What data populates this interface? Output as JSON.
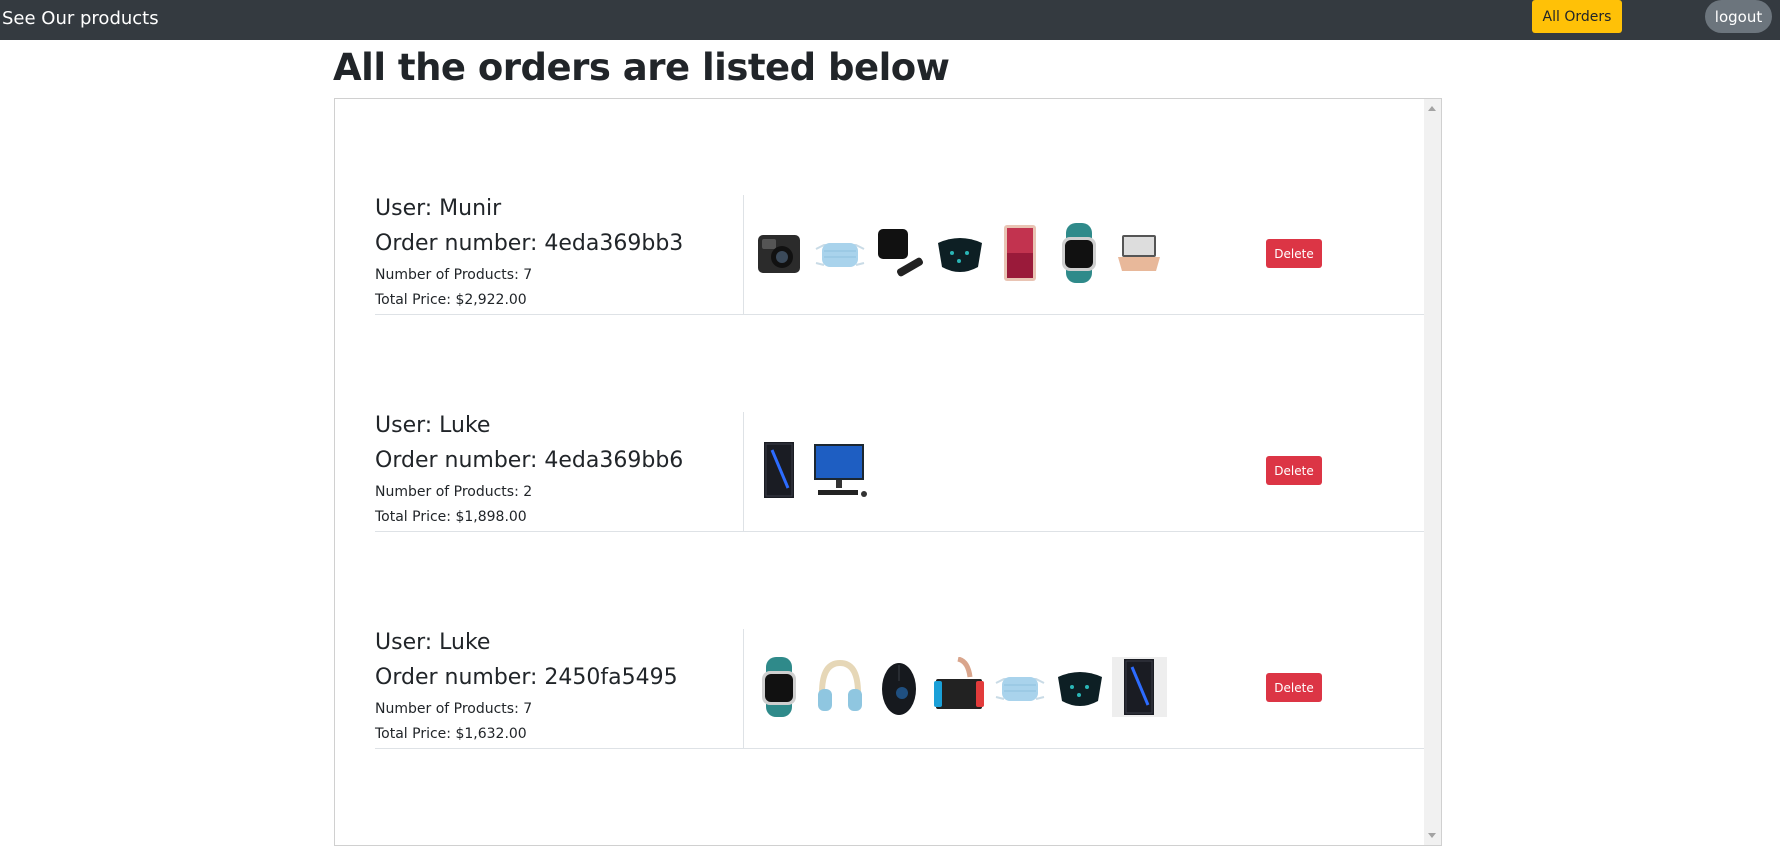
{
  "nav": {
    "brand": "See Our products",
    "all_orders": "All Orders",
    "logout": "logout"
  },
  "page": {
    "title": "All the orders are listed below"
  },
  "orders": [
    {
      "user": "User: Munir",
      "order_number": "Order number: 4eda369bb3",
      "num_products": "Number of Products: 7",
      "total_price": "Total Price: $2,922.00",
      "delete_label": "Delete",
      "products": [
        "action-camera",
        "surgical-mask",
        "streaming-box",
        "black-mask",
        "tablet",
        "smartwatch",
        "laptop"
      ]
    },
    {
      "user": "User: Luke",
      "order_number": "Order number: 4eda369bb6",
      "num_products": "Number of Products: 2",
      "total_price": "Total Price: $1,898.00",
      "delete_label": "Delete",
      "products": [
        "gaming-pc-tower",
        "desktop-monitor"
      ]
    },
    {
      "user": "User: Luke",
      "order_number": "Order number: 2450fa5495",
      "num_products": "Number of Products: 7",
      "total_price": "Total Price: $1,632.00",
      "delete_label": "Delete",
      "products": [
        "smartwatch",
        "headphones",
        "gaming-mouse",
        "game-console",
        "surgical-mask",
        "black-mask",
        "gaming-pc-tower"
      ]
    }
  ],
  "colors": {
    "navbar": "#343a40",
    "all_orders_button": "#ffc107",
    "logout_button": "#6c757d",
    "delete_button": "#dc3545"
  }
}
